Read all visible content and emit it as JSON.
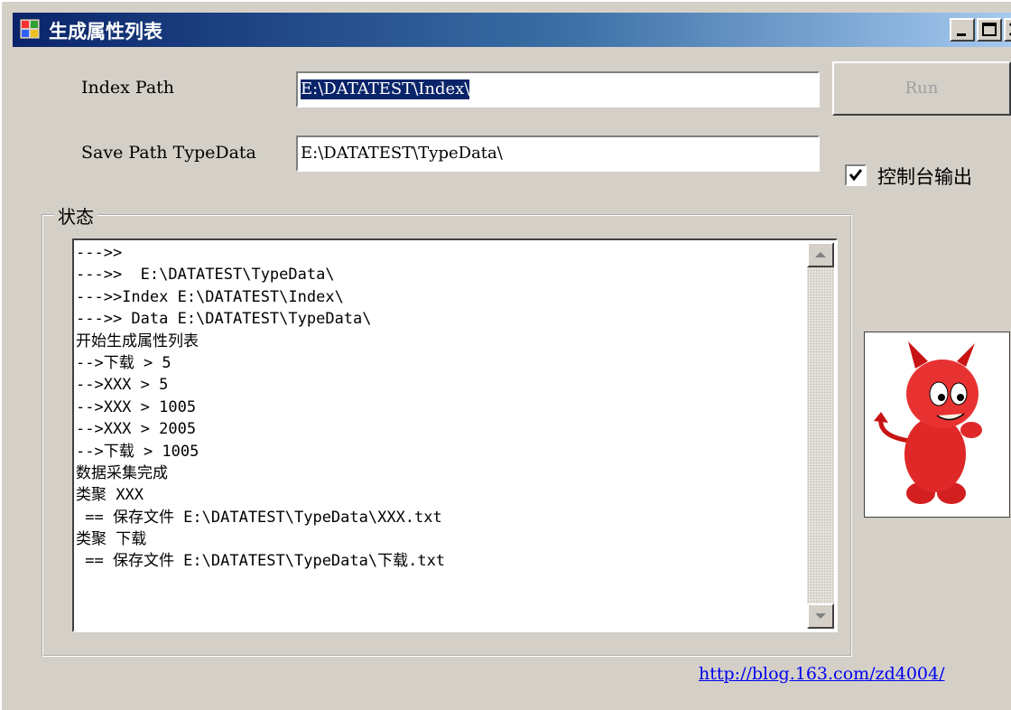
{
  "window": {
    "title": "生成属性列表"
  },
  "form": {
    "index_path": {
      "label": "Index Path",
      "value": "E:\\DATATEST\\Index\\"
    },
    "save_path": {
      "label": "Save Path TypeData",
      "value": "E:\\DATATEST\\TypeData\\"
    },
    "run_label": "Run",
    "console_output": {
      "label": "控制台输出",
      "checked": true
    }
  },
  "status": {
    "legend": "状态",
    "lines": [
      "--->>",
      "--->>  E:\\DATATEST\\TypeData\\",
      "--->>Index E:\\DATATEST\\Index\\",
      "--->> Data E:\\DATATEST\\TypeData\\",
      "开始生成属性列表",
      "-->下载 > 5",
      "-->XXX > 5",
      "-->XXX > 1005",
      "-->XXX > 2005",
      "-->下载 > 1005",
      "数据采集完成",
      "类聚 XXX",
      " == 保存文件 E:\\DATATEST\\TypeData\\XXX.txt",
      "类聚 下载",
      " == 保存文件 E:\\DATATEST\\TypeData\\下载.txt"
    ]
  },
  "link": "http://blog.163.com/zd4004/",
  "icons": [
    "app-icon",
    "minimize-icon",
    "maximize-icon",
    "close-icon",
    "checkmark-icon",
    "scroll-up-arrow-icon",
    "scroll-down-arrow-icon",
    "devil-mascot-image"
  ],
  "colors": {
    "titlebar_start": "#0a246a",
    "titlebar_end": "#a6caf0",
    "window_bg": "#d4d0c8",
    "link": "#0000ee",
    "selection": "#0a246a"
  }
}
